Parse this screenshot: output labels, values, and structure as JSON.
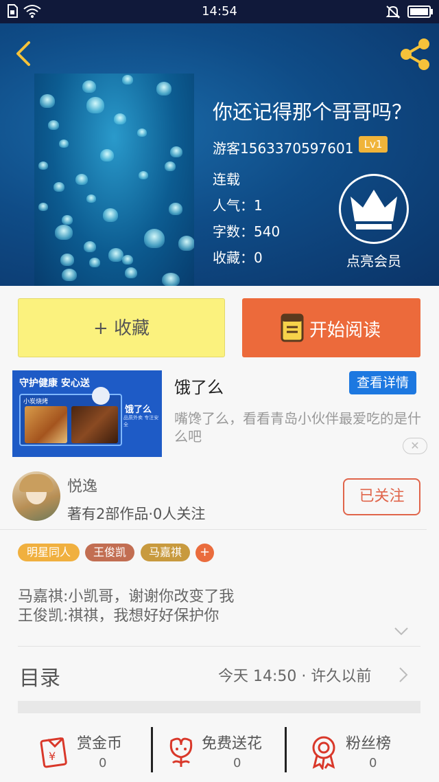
{
  "status_bar": {
    "time": "14:54"
  },
  "book": {
    "title": "你还记得那个哥哥吗？",
    "author": "游客1563370597601",
    "level": "Lv1",
    "status": "连载",
    "popularity": "人气：1",
    "word_count": "字数：540",
    "favorites": "收藏：0",
    "vip_label": "点亮会员"
  },
  "actions": {
    "favorite_label": "+ 收藏",
    "read_label": "开始阅读"
  },
  "ad": {
    "image_text_1": "守护健康 安心送",
    "image_text_2": "小炭烧烤",
    "image_brand": "饿了么",
    "image_slogan": "品质外卖 专注安全",
    "name": "饿了么",
    "detail_button": "查看详情",
    "description": "嘴馋了么，看看青岛小伙伴最爱吃的是什么吧",
    "close": "✕"
  },
  "author_info": {
    "name": "悦逸",
    "info": "著有2部作品·0人关注",
    "follow_label": "已关注"
  },
  "tags": [
    {
      "label": "明星同人",
      "color": "#f0b03f"
    },
    {
      "label": "王俊凯",
      "color": "#c26e52"
    },
    {
      "label": "马嘉祺",
      "color": "#c89a3e"
    }
  ],
  "tag_add": "+",
  "description_lines": [
    "马嘉祺:小凯哥，谢谢你改变了我",
    "王俊凯:祺祺，我想好好保护你"
  ],
  "catalog": {
    "title": "目录",
    "meta": "今天 14:50 · 许久以前"
  },
  "bottom_bar": [
    {
      "label": "赏金币",
      "count": "0",
      "icon": "reward-coin-icon"
    },
    {
      "label": "免费送花",
      "count": "0",
      "icon": "flower-icon"
    },
    {
      "label": "粉丝榜",
      "count": "0",
      "icon": "medal-icon"
    }
  ],
  "colors": {
    "accent_orange": "#ec6a3b",
    "favorite_yellow": "#fbf27e",
    "level_badge": "#f0b43a",
    "ad_button_blue": "#1d78e0"
  }
}
